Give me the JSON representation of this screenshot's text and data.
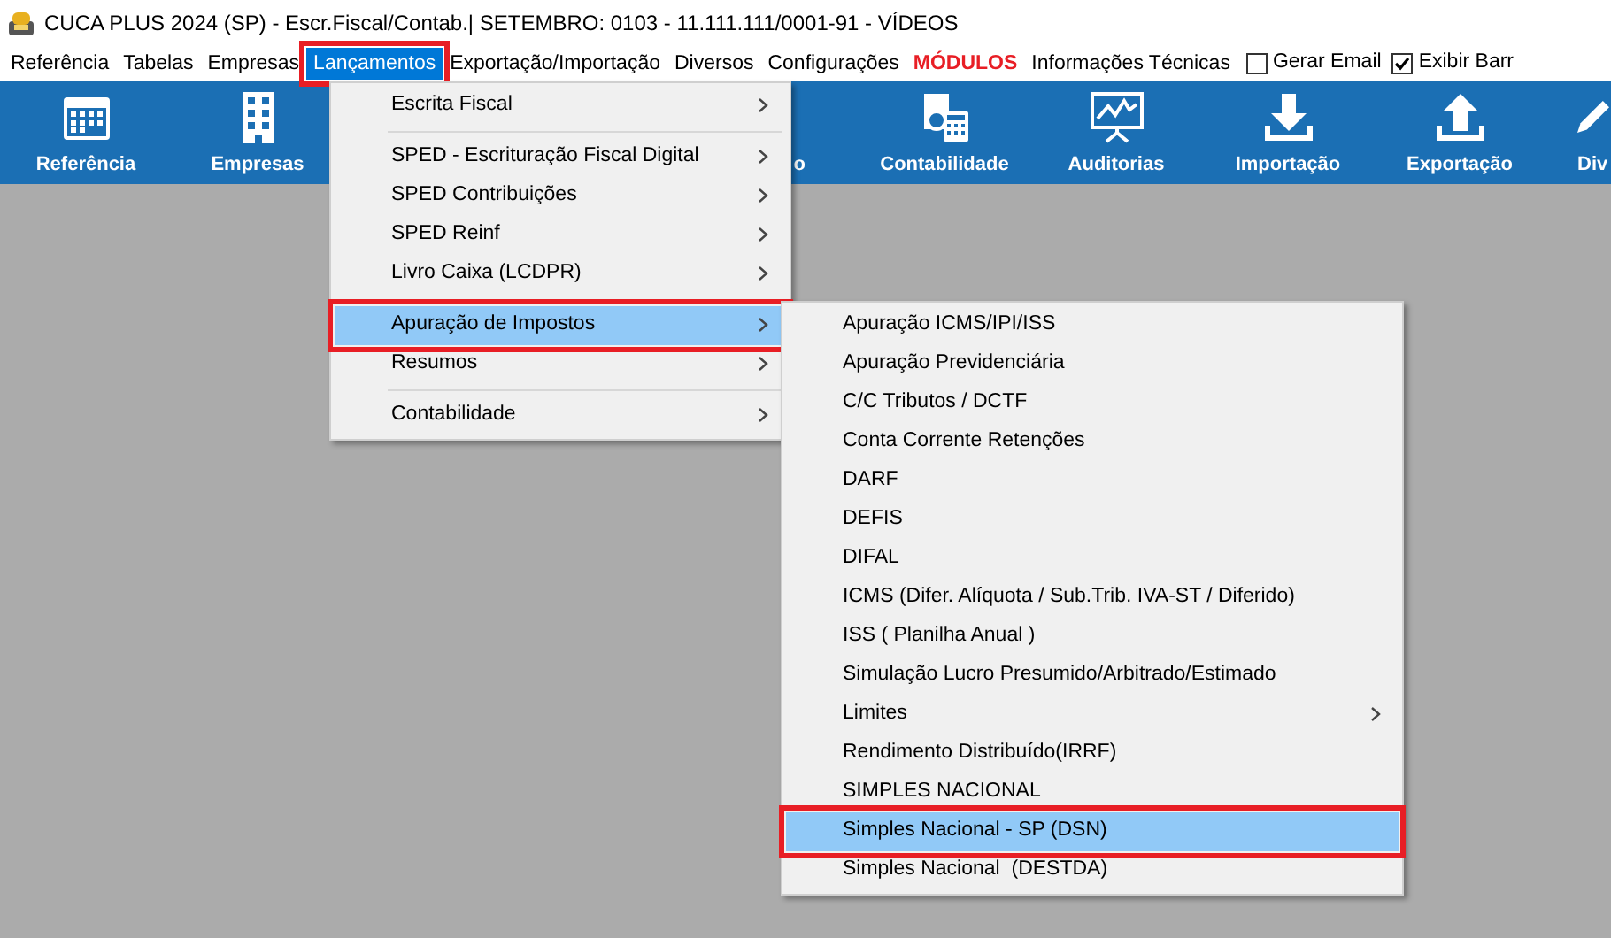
{
  "window": {
    "title": "CUCA PLUS 2024 (SP) - Escr.Fiscal/Contab.| SETEMBRO: 0103 - 11.111.111/0001-91 - VÍDEOS"
  },
  "menubar": [
    {
      "label": "Referência",
      "kind": "menu",
      "selected": false,
      "highlighted": false
    },
    {
      "label": "Tabelas",
      "kind": "menu",
      "selected": false,
      "highlighted": false
    },
    {
      "label": "Empresas",
      "kind": "menu",
      "selected": false,
      "highlighted": false
    },
    {
      "label": "Lançamentos",
      "kind": "menu",
      "selected": true,
      "highlighted": true
    },
    {
      "label": "Exportação/Importação",
      "kind": "menu",
      "selected": false,
      "highlighted": false
    },
    {
      "label": "Diversos",
      "kind": "menu",
      "selected": false,
      "highlighted": false
    },
    {
      "label": "Configurações",
      "kind": "menu",
      "selected": false,
      "highlighted": false
    },
    {
      "label": "MÓDULOS",
      "kind": "emphasis",
      "selected": false,
      "highlighted": false
    },
    {
      "label": "Informações Técnicas",
      "kind": "menu",
      "selected": false,
      "highlighted": false
    },
    {
      "label": "Gerar Email",
      "kind": "checkbox",
      "checked": false
    },
    {
      "label": "Exibir Barr",
      "kind": "checkbox",
      "checked": true
    }
  ],
  "toolbar": [
    {
      "label": "Referência",
      "kind": "calendar"
    },
    {
      "label": "Empresas",
      "kind": "building"
    },
    {
      "label": "o",
      "kind": "partial"
    },
    {
      "label": "Contabilidade",
      "kind": "calculator"
    },
    {
      "label": "Auditorias",
      "kind": "chart"
    },
    {
      "label": "Importação",
      "kind": "download"
    },
    {
      "label": "Exportação",
      "kind": "upload"
    },
    {
      "label": "Div",
      "kind": "pen"
    }
  ],
  "menu": [
    {
      "kind": "item",
      "label": "Escrita Fiscal",
      "submenu": true,
      "selected": false,
      "highlighted": false
    },
    {
      "kind": "separator"
    },
    {
      "kind": "item",
      "label": "SPED - Escrituração Fiscal Digital",
      "submenu": true,
      "selected": false,
      "highlighted": false
    },
    {
      "kind": "item",
      "label": "SPED Contribuições",
      "submenu": true,
      "selected": false,
      "highlighted": false
    },
    {
      "kind": "item",
      "label": "SPED Reinf",
      "submenu": true,
      "selected": false,
      "highlighted": false
    },
    {
      "kind": "item",
      "label": "Livro Caixa (LCDPR)",
      "submenu": true,
      "selected": false,
      "highlighted": false
    },
    {
      "kind": "separator"
    },
    {
      "kind": "item",
      "label": "Apuração de Impostos",
      "submenu": true,
      "selected": true,
      "highlighted": true
    },
    {
      "kind": "item",
      "label": "Resumos",
      "submenu": true,
      "selected": false,
      "highlighted": false
    },
    {
      "kind": "separator"
    },
    {
      "kind": "item",
      "label": "Contabilidade",
      "submenu": true,
      "selected": false,
      "highlighted": false
    }
  ],
  "submenu": [
    {
      "kind": "item",
      "label": "Apuração ICMS/IPI/ISS",
      "submenu": false,
      "selected": false,
      "highlighted": false
    },
    {
      "kind": "item",
      "label": "Apuração Previdenciária",
      "submenu": false,
      "selected": false,
      "highlighted": false
    },
    {
      "kind": "item",
      "label": "C/C Tributos / DCTF",
      "submenu": false,
      "selected": false,
      "highlighted": false
    },
    {
      "kind": "item",
      "label": "Conta Corrente Retenções",
      "submenu": false,
      "selected": false,
      "highlighted": false
    },
    {
      "kind": "item",
      "label": "DARF",
      "submenu": false,
      "selected": false,
      "highlighted": false
    },
    {
      "kind": "item",
      "label": "DEFIS",
      "submenu": false,
      "selected": false,
      "highlighted": false
    },
    {
      "kind": "item",
      "label": "DIFAL",
      "submenu": false,
      "selected": false,
      "highlighted": false
    },
    {
      "kind": "item",
      "label": "ICMS (Difer. Alíquota / Sub.Trib. IVA-ST / Diferido)",
      "submenu": false,
      "selected": false,
      "highlighted": false
    },
    {
      "kind": "item",
      "label": "ISS ( Planilha Anual )",
      "submenu": false,
      "selected": false,
      "highlighted": false
    },
    {
      "kind": "item",
      "label": "Simulação Lucro Presumido/Arbitrado/Estimado",
      "submenu": false,
      "selected": false,
      "highlighted": false
    },
    {
      "kind": "item",
      "label": "Limites",
      "submenu": true,
      "selected": false,
      "highlighted": false
    },
    {
      "kind": "item",
      "label": "Rendimento Distribuído(IRRF)",
      "submenu": false,
      "selected": false,
      "highlighted": false
    },
    {
      "kind": "item",
      "label": "SIMPLES NACIONAL",
      "submenu": false,
      "selected": false,
      "highlighted": false
    },
    {
      "kind": "item",
      "label": "Simples Nacional - SP (DSN)",
      "submenu": false,
      "selected": true,
      "highlighted": true
    },
    {
      "kind": "item",
      "label": "Simples Nacional  (DESTDA)",
      "submenu": false,
      "selected": false,
      "highlighted": false
    }
  ]
}
